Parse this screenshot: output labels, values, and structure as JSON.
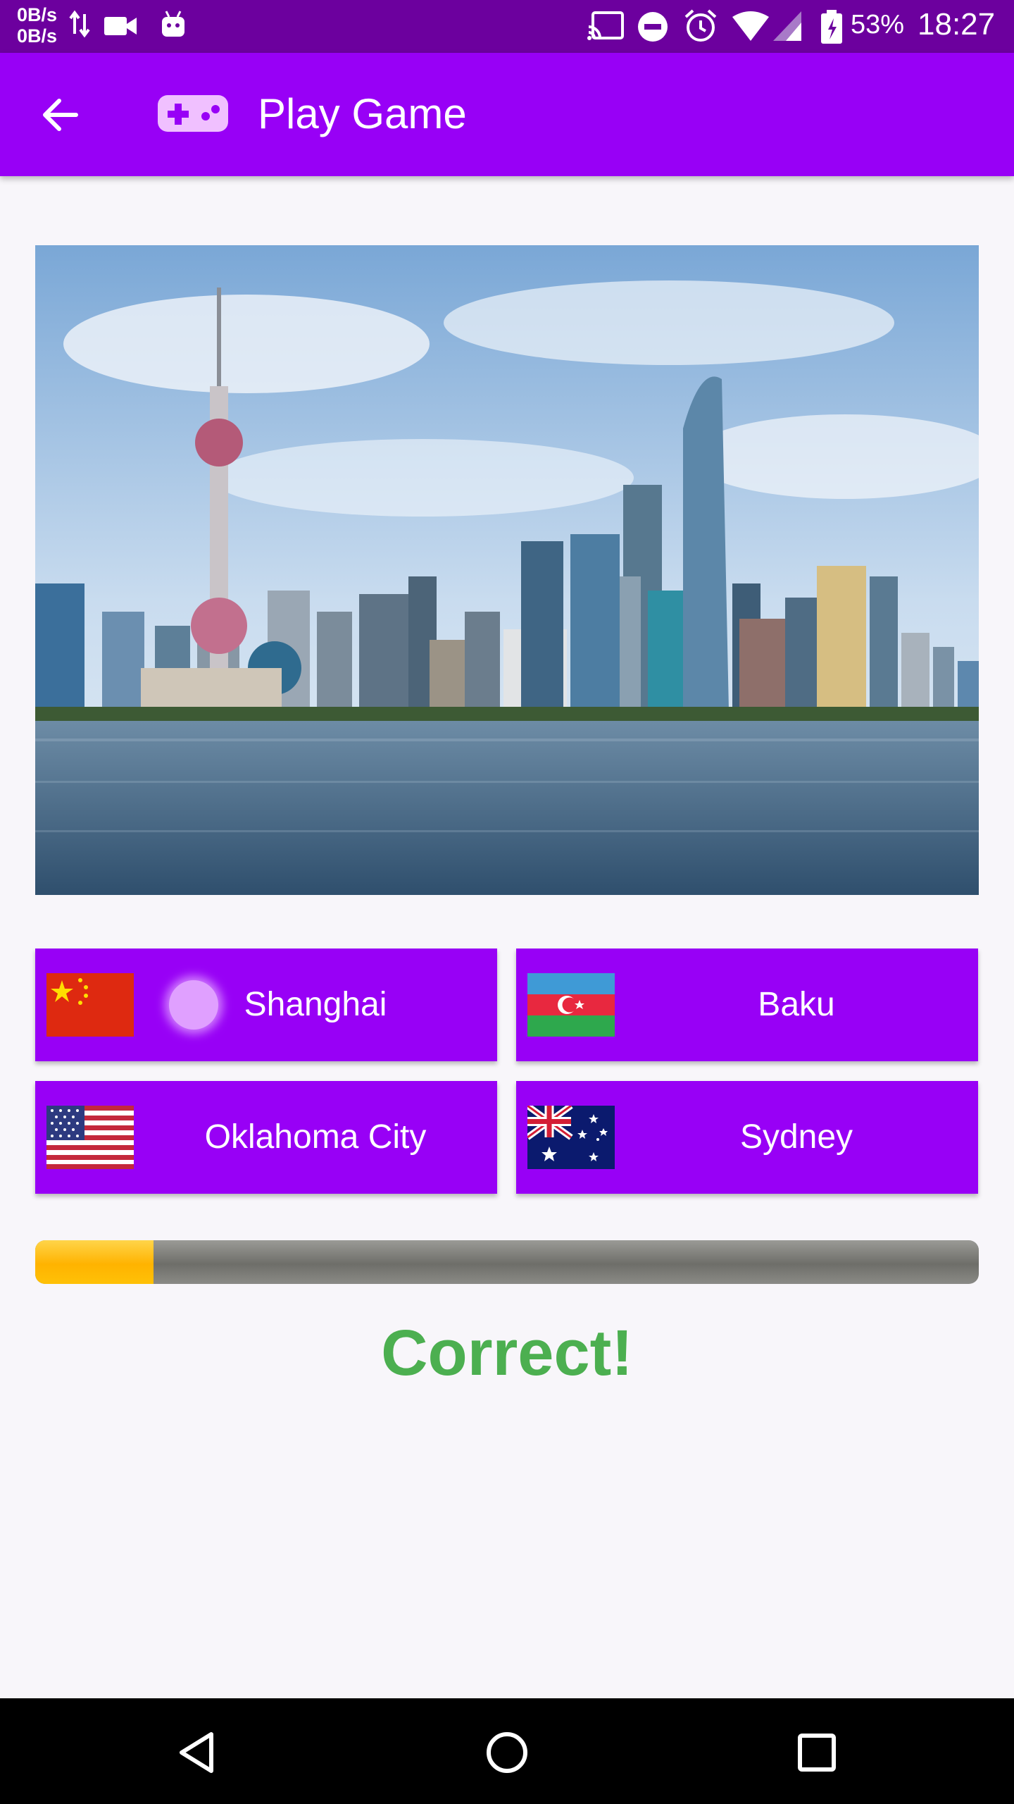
{
  "status_bar": {
    "net_up": "0B/s",
    "net_down": "0B/s",
    "battery": "53%",
    "time": "18:27"
  },
  "app_bar": {
    "title": "Play Game",
    "icons": [
      "back-arrow-icon",
      "gamepad-icon"
    ]
  },
  "question_image": "shanghai-skyline",
  "options": [
    {
      "label": "Shanghai",
      "flag": "china-flag-icon"
    },
    {
      "label": "Baku",
      "flag": "azerbaijan-flag-icon"
    },
    {
      "label": "Oklahoma City",
      "flag": "usa-flag-icon"
    },
    {
      "label": "Sydney",
      "flag": "australia-flag-icon"
    }
  ],
  "progress": {
    "fraction": 0.125,
    "fill_color": "#ffc107",
    "track_color": "#7a7a75"
  },
  "result": {
    "text": "Correct!",
    "color": "#4caf50"
  },
  "colors": {
    "primary": "#9800f6",
    "status_bar": "#6c009e",
    "background": "#f8f6fa"
  },
  "nav_bar": {
    "icons": [
      "back-triangle-icon",
      "home-circle-icon",
      "recents-square-icon"
    ]
  }
}
